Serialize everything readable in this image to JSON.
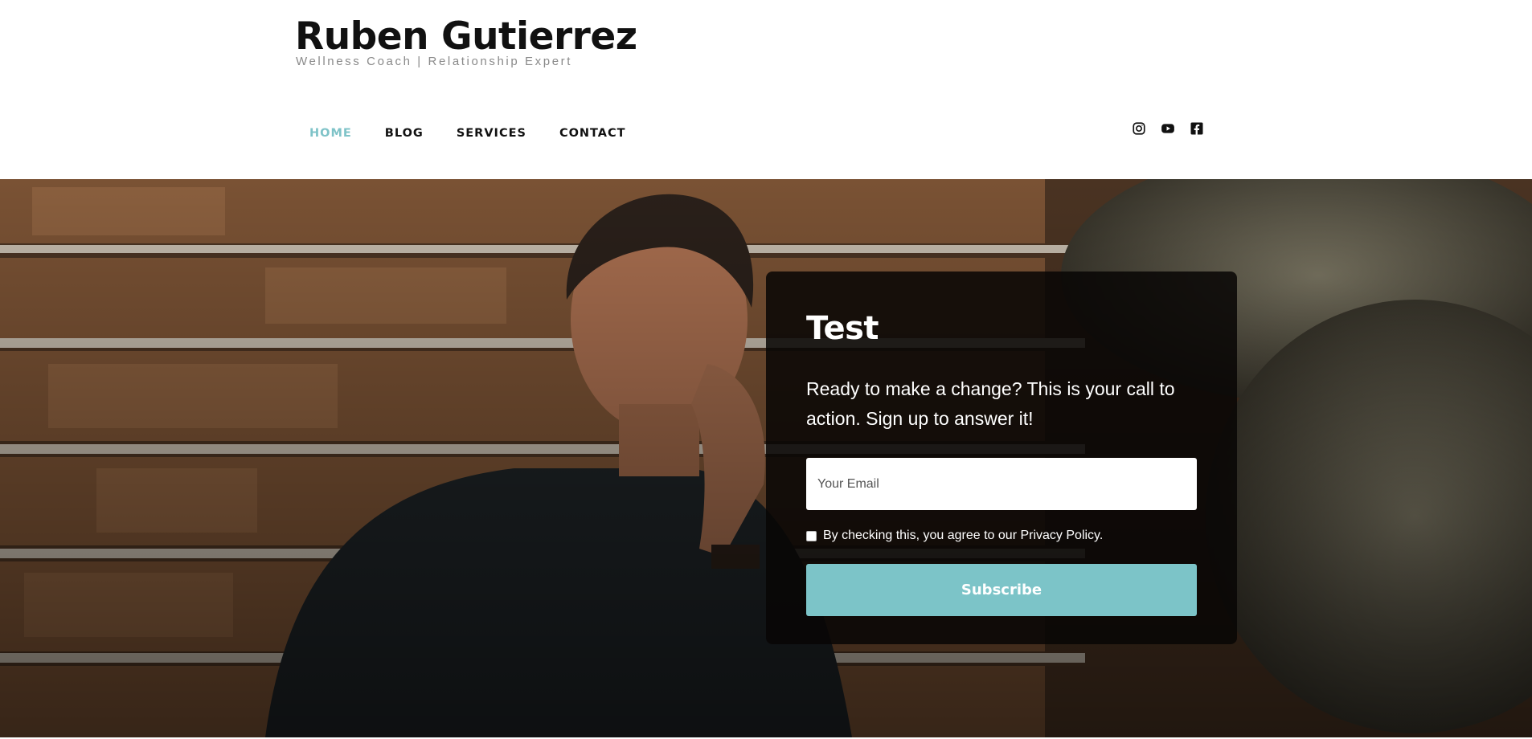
{
  "site": {
    "title": "Ruben Gutierrez",
    "tagline": "Wellness Coach | Relationship Expert"
  },
  "nav": {
    "items": [
      {
        "label": "HOME",
        "active": true
      },
      {
        "label": "BLOG",
        "active": false
      },
      {
        "label": "SERVICES",
        "active": false
      },
      {
        "label": "CONTACT",
        "active": false
      }
    ]
  },
  "social": {
    "icons": [
      "instagram-icon",
      "youtube-icon",
      "facebook-icon"
    ]
  },
  "hero": {
    "card": {
      "title": "Test",
      "text": "Ready to make a change? This is your call to action. Sign up to answer it!",
      "email_placeholder": "Your Email",
      "consent_text": "By checking this, you agree to our Privacy Policy.",
      "consent_checked": false,
      "subscribe_label": "Subscribe"
    }
  },
  "colors": {
    "accent": "#7cc4c8",
    "text_dark": "#111111",
    "tagline": "#8a8a8a"
  }
}
